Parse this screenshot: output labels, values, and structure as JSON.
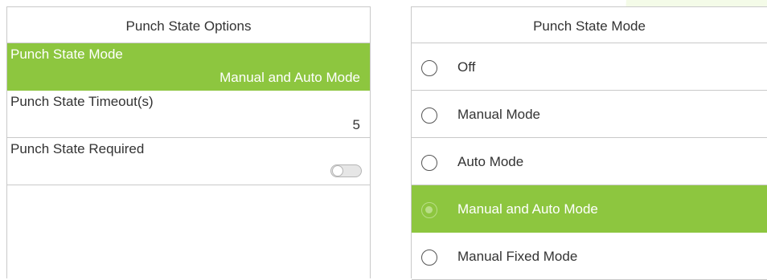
{
  "left_screen": {
    "title": "Punch State Options",
    "items": [
      {
        "label": "Punch State Mode",
        "value": "Manual and Auto Mode",
        "selected": true
      },
      {
        "label": "Punch State Timeout(s)",
        "value": "5",
        "selected": false
      },
      {
        "label": "Punch State Required",
        "toggle_on": false,
        "selected": false
      }
    ]
  },
  "right_screen": {
    "title": "Punch State Mode",
    "options": [
      {
        "label": "Off",
        "selected": false
      },
      {
        "label": "Manual Mode",
        "selected": false
      },
      {
        "label": "Auto Mode",
        "selected": false
      },
      {
        "label": "Manual and Auto Mode",
        "selected": true
      },
      {
        "label": "Manual Fixed Mode",
        "selected": false
      }
    ]
  },
  "colors": {
    "accent": "#8dc63f",
    "border": "#c9c9c9",
    "text": "#333333"
  }
}
